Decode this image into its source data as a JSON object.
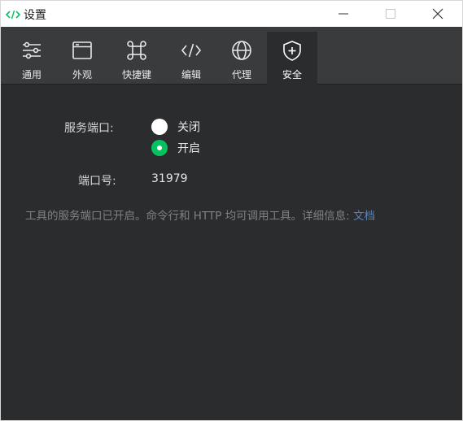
{
  "window": {
    "title": "设置",
    "app_icon": "code-brackets-icon",
    "accent_color": "#07c160",
    "link_color": "#5b80b9"
  },
  "tabs": [
    {
      "label": "通用",
      "icon": "sliders-icon",
      "active": false
    },
    {
      "label": "外观",
      "icon": "window-icon",
      "active": false
    },
    {
      "label": "快捷键",
      "icon": "command-icon",
      "active": false
    },
    {
      "label": "编辑",
      "icon": "code-icon",
      "active": false
    },
    {
      "label": "代理",
      "icon": "globe-icon",
      "active": false
    },
    {
      "label": "安全",
      "icon": "shield-plus-icon",
      "active": true
    }
  ],
  "security": {
    "service_port_label": "服务端口:",
    "options": [
      {
        "label": "关闭",
        "selected": false
      },
      {
        "label": "开启",
        "selected": true
      }
    ],
    "port_label": "端口号:",
    "port_value": "31979",
    "hint_text": "工具的服务端口已开启。命令行和 HTTP 均可调用工具。详细信息: ",
    "hint_link": "文档"
  }
}
